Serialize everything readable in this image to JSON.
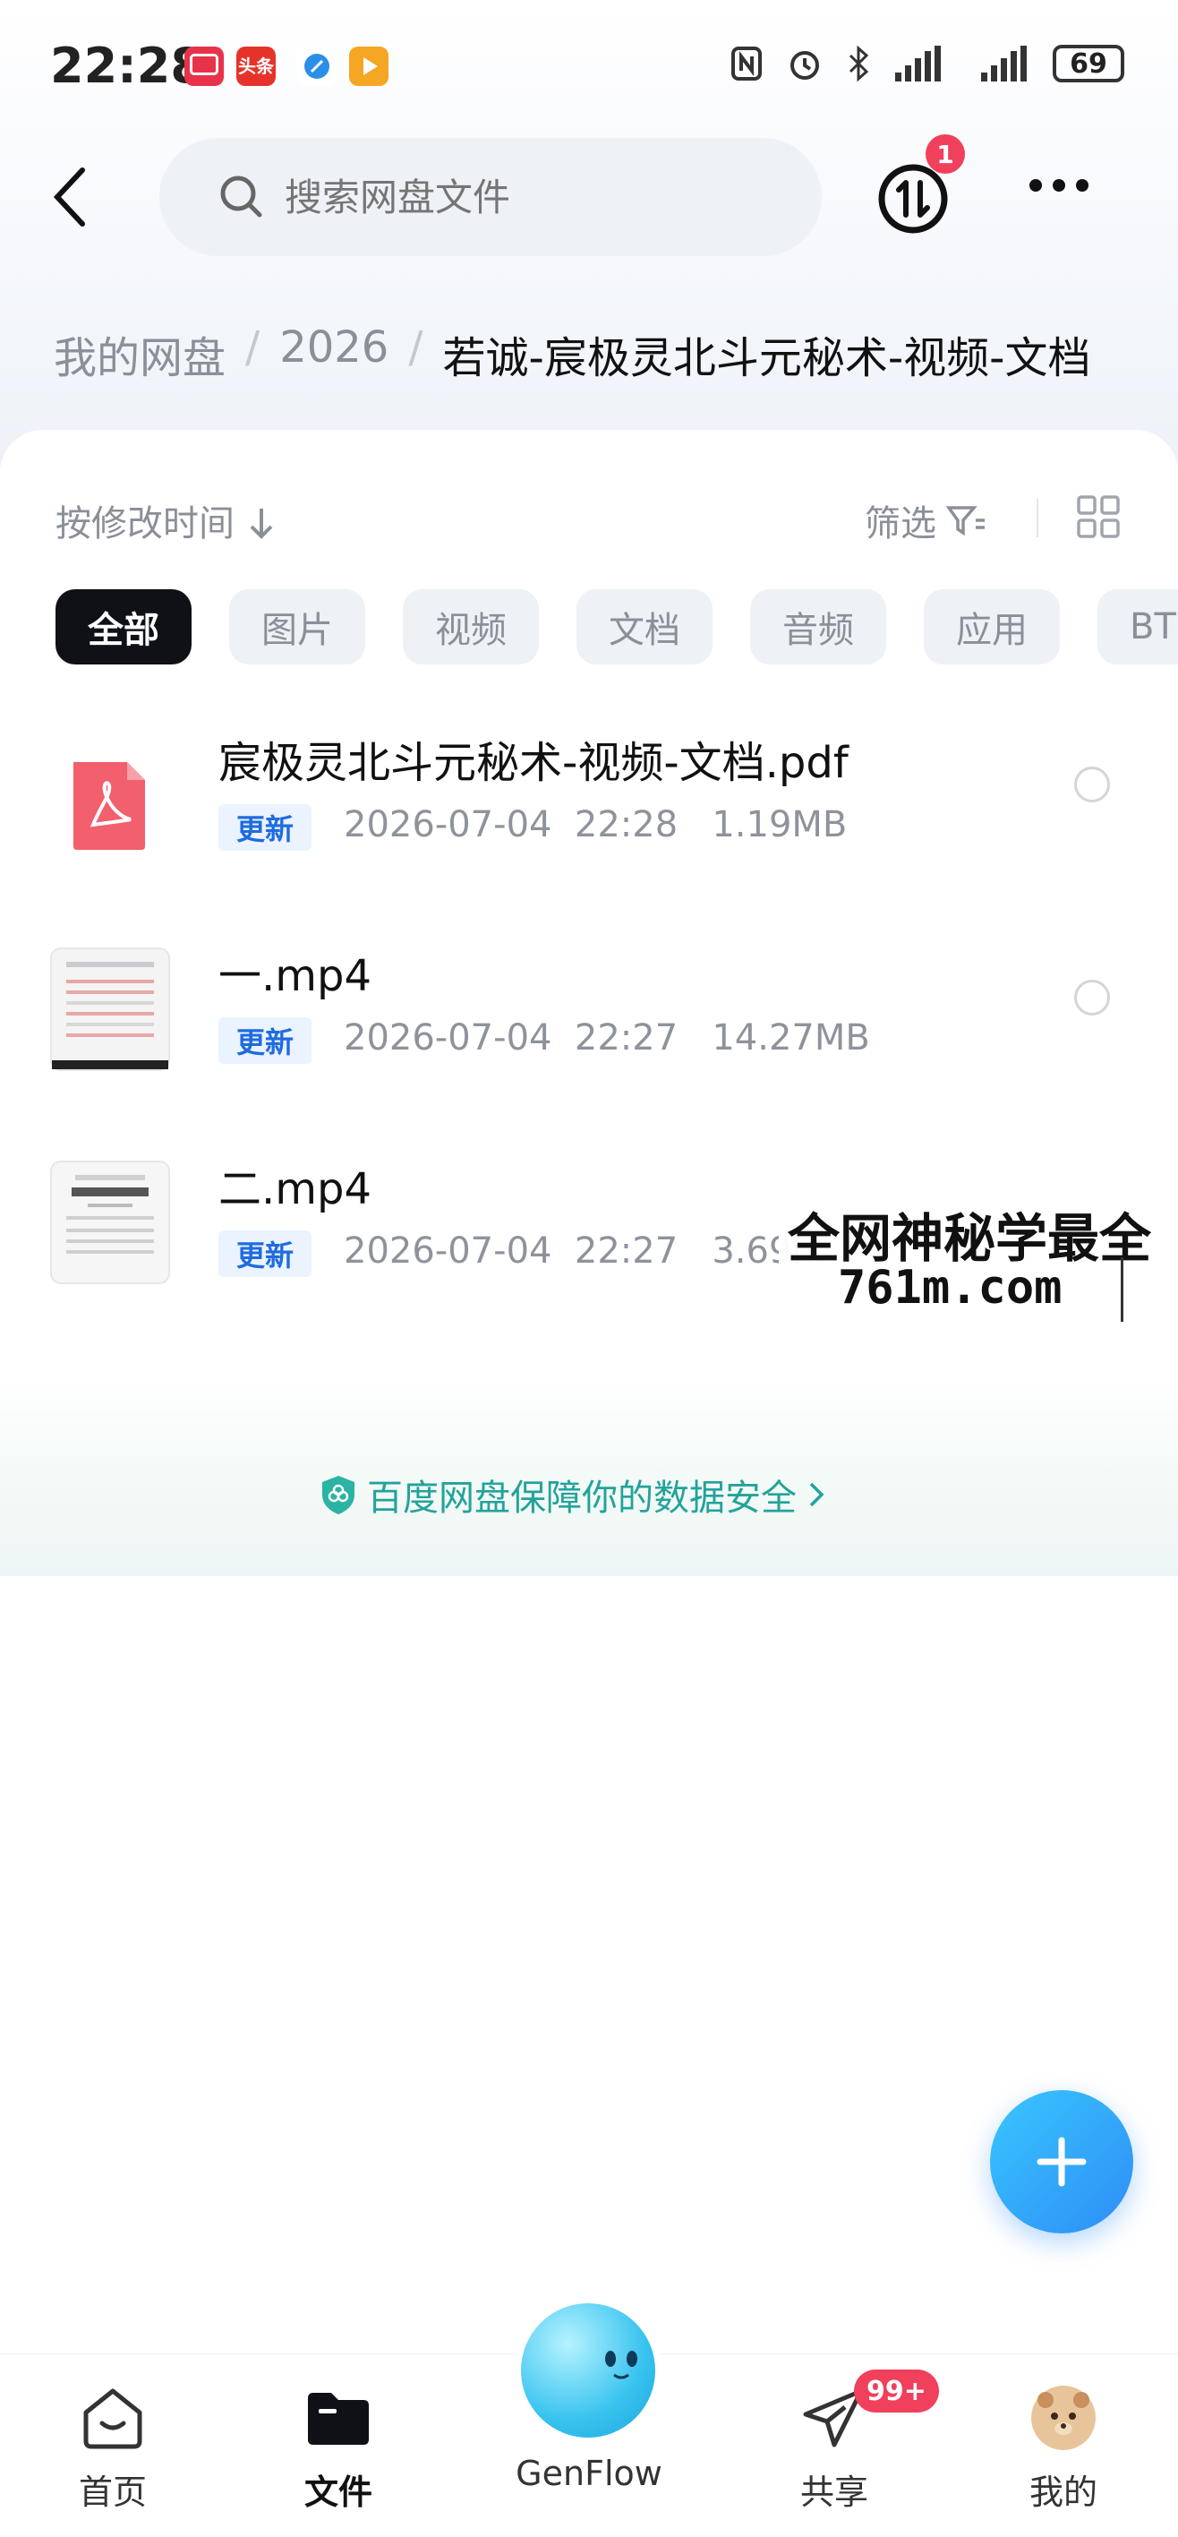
{
  "status_bar": {
    "time": "22:28",
    "battery": "69",
    "notification_icons": [
      "tv-app-icon",
      "toutiao-icon",
      "feather-app-icon",
      "video-app-icon"
    ],
    "toutiao_label": "头条"
  },
  "header": {
    "search_placeholder": "搜索网盘文件",
    "transfer_badge": "1"
  },
  "breadcrumb": {
    "root": "我的网盘",
    "sep": "/",
    "level1": "2026",
    "current": "若诚-宸极灵北斗元秘术-视频-文档"
  },
  "toolbar": {
    "sort_label": "按修改时间",
    "filter_label": "筛选"
  },
  "chips": [
    "全部",
    "图片",
    "视频",
    "文档",
    "音频",
    "应用",
    "BT"
  ],
  "files": [
    {
      "name": "宸极灵北斗元秘术-视频-文档.pdf",
      "tag": "更新",
      "date": "2026-07-04",
      "time": "22:28",
      "size": "1.19MB",
      "type": "pdf-icon"
    },
    {
      "name": "一.mp4",
      "tag": "更新",
      "date": "2026-07-04",
      "time": "22:27",
      "size": "14.27MB",
      "type": "video-thumbnail"
    },
    {
      "name": "二.mp4",
      "tag": "更新",
      "date": "2026-07-04",
      "time": "22:27",
      "size": "3.69l",
      "type": "video-thumbnail"
    }
  ],
  "watermark": {
    "line1": "全网神秘学最全",
    "line2": "761m.com"
  },
  "safety_notice": "百度网盘保障你的数据安全",
  "bottom_nav": {
    "home": "首页",
    "files": "文件",
    "genflow": "GenFlow",
    "share": "共享",
    "share_badge": "99+",
    "me": "我的"
  },
  "colors": {
    "accent": "#2e8df5",
    "badge": "#f0405b",
    "tag_text": "#1f6be0",
    "safe_text": "#22a39a"
  }
}
